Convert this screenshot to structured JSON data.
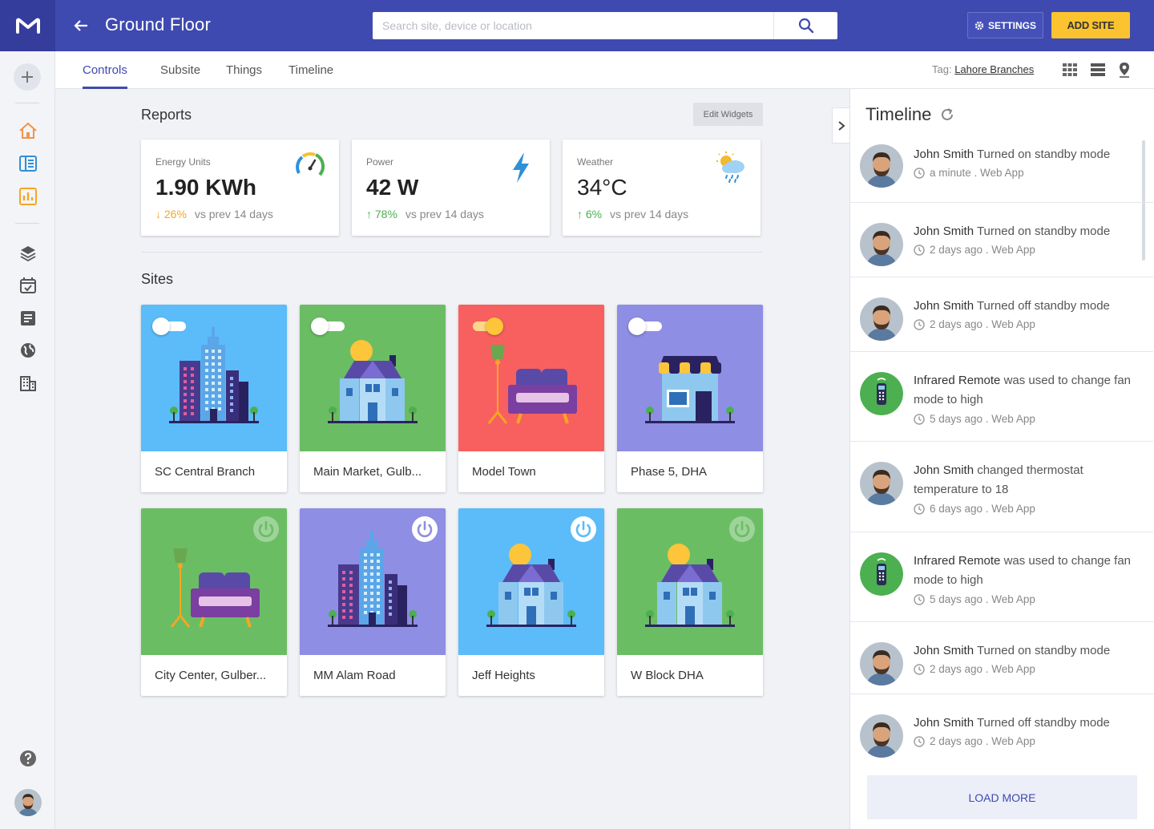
{
  "header": {
    "title": "Ground Floor",
    "search_placeholder": "Search site, device or location",
    "settings_label": "SETTINGS",
    "add_site_label": "ADD SITE"
  },
  "tabs": [
    {
      "label": "Controls",
      "active": true
    },
    {
      "label": "Subsite",
      "active": false
    },
    {
      "label": "Things",
      "active": false
    },
    {
      "label": "Timeline",
      "active": false
    }
  ],
  "tag": {
    "prefix": "Tag:",
    "value": "Lahore Branches"
  },
  "reports": {
    "title": "Reports",
    "edit_label": "Edit Widgets",
    "cards": [
      {
        "label": "Energy Units",
        "value": "1.90 KWh",
        "delta": "26%",
        "direction": "down",
        "compare": "vs prev 14 days",
        "icon": "gauge-icon"
      },
      {
        "label": "Power",
        "value": "42 W",
        "delta": "78%",
        "direction": "up",
        "compare": "vs prev 14 days",
        "icon": "lightning-icon"
      },
      {
        "label": "Weather",
        "value": "34°C",
        "delta": "6%",
        "direction": "up",
        "compare": "vs prev 14 days",
        "icon": "weather-icon"
      }
    ]
  },
  "sites": {
    "title": "Sites",
    "items": [
      {
        "name": "SC Central Branch",
        "color": "#5bbcf9",
        "illustration": "building",
        "control": "toggle",
        "on": false
      },
      {
        "name": "Main Market, Gulb...",
        "color": "#6bbd64",
        "illustration": "house",
        "control": "toggle",
        "on": false
      },
      {
        "name": "Model Town",
        "color": "#f86060",
        "illustration": "sofa",
        "control": "toggle",
        "on": true
      },
      {
        "name": "Phase 5, DHA",
        "color": "#8e8ee4",
        "illustration": "shop",
        "control": "toggle",
        "on": false
      },
      {
        "name": "City Center, Gulber...",
        "color": "#6bbd64",
        "illustration": "sofa",
        "control": "power",
        "on": false
      },
      {
        "name": "MM Alam Road",
        "color": "#8e8ee4",
        "illustration": "building",
        "control": "power",
        "on": true
      },
      {
        "name": "Jeff Heights",
        "color": "#5bbcf9",
        "illustration": "house",
        "control": "power",
        "on": true
      },
      {
        "name": "W Block DHA",
        "color": "#6bbd64",
        "illustration": "house",
        "control": "power",
        "on": false
      }
    ]
  },
  "timeline": {
    "title": "Timeline",
    "load_more": "LOAD MORE",
    "items": [
      {
        "actor": "John Smith",
        "action": "Turned on standby mode",
        "time": "a minute . Web App",
        "avatar": "person"
      },
      {
        "actor": "John Smith",
        "action": "Turned on standby mode",
        "time": "2 days ago . Web App",
        "avatar": "person"
      },
      {
        "actor": "John Smith",
        "action": "Turned off standby mode",
        "time": "2 days ago . Web App",
        "avatar": "person"
      },
      {
        "actor": "Infrared Remote",
        "action": "was used to change fan mode to high",
        "time": "5 days ago . Web App",
        "avatar": "remote"
      },
      {
        "actor": "John Smith",
        "action": "changed thermostat temperature to 18",
        "time": "6 days ago . Web App",
        "avatar": "person"
      },
      {
        "actor": "Infrared Remote",
        "action": "was used to change fan mode to high",
        "time": "5 days ago . Web App",
        "avatar": "remote"
      },
      {
        "actor": "John Smith",
        "action": "Turned on standby mode",
        "time": "2 days ago . Web App",
        "avatar": "person"
      },
      {
        "actor": "John Smith",
        "action": "Turned off standby mode",
        "time": "2 days ago . Web App",
        "avatar": "person"
      }
    ]
  },
  "colors": {
    "primary": "#3f4ab0",
    "accent": "#fbc32f",
    "up": "#4caf50",
    "down": "#f5a623"
  }
}
